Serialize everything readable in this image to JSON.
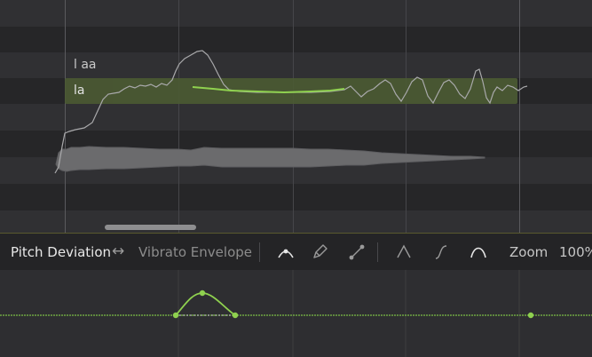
{
  "roll": {
    "lyric_above": "l aa",
    "note_lyric": "la"
  },
  "param_bar": {
    "primary_param": "Pitch Deviation",
    "swap_icon": "↔",
    "secondary_param": "Vibrato Envelope",
    "zoom_label": "Zoom",
    "zoom_value": "100%"
  },
  "tools": [
    "curve-select-icon",
    "pencil-icon",
    "line-icon",
    "sharp-peak-icon",
    "s-curve-icon",
    "arch-icon"
  ],
  "colors": {
    "accent": "#8fd14f",
    "note_fill": "#4b5a33",
    "pitch_line": "#a8a8a8",
    "waveform": "#6a6a6c",
    "lane_line": "#7cbf46"
  }
}
